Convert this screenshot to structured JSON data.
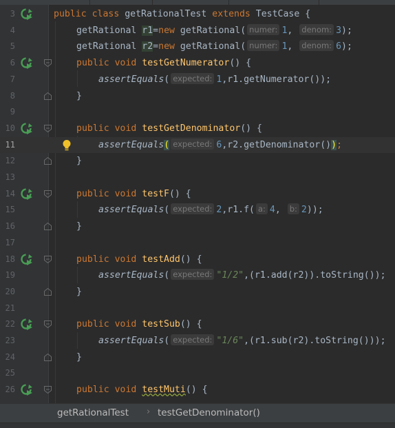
{
  "line_numbers": [
    "3",
    "4",
    "5",
    "6",
    "7",
    "8",
    "9",
    "10",
    "11",
    "12",
    "13",
    "14",
    "15",
    "16",
    "17",
    "18",
    "19",
    "20",
    "21",
    "22",
    "23",
    "24",
    "25",
    "26"
  ],
  "hints": {
    "numer": "numer:",
    "denom": "denom:",
    "expected": "expected:",
    "a": "a:",
    "b": "b:"
  },
  "code": {
    "l3": {
      "kw1": "public class ",
      "name": "getRationalTest ",
      "kw2": "extends ",
      "rest": "TestCase {"
    },
    "l4": {
      "type": "getRational ",
      "var": "r1",
      "assign": "=",
      "kw": "new ",
      "call": "getRational(",
      "n1": "1",
      "comma": ", ",
      "n2": "3",
      "end": ");"
    },
    "l5": {
      "type": "getRational ",
      "var": "r2",
      "assign": "=",
      "kw": "new ",
      "call": "getRational(",
      "n1": "1",
      "comma": ", ",
      "n2": "6",
      "end": ");"
    },
    "l6": {
      "kw": "public void ",
      "name": "testGetNumerator",
      "rest": "() {"
    },
    "l7": {
      "call": "assertEquals",
      "open": "(",
      "n": "1",
      "rest": ",r1.getNumerator());"
    },
    "l8": {
      "text": "}"
    },
    "l10": {
      "kw": "public void ",
      "name": "testGetDenominator",
      "rest": "() {"
    },
    "l11": {
      "call": "assertEquals",
      "open": "(",
      "n": "6",
      "rest": ",r2.getDenominator()",
      "close": ")",
      "semi": ";"
    },
    "l12": {
      "text": "}"
    },
    "l14": {
      "kw": "public void ",
      "name": "testF",
      "rest": "() {"
    },
    "l15": {
      "call": "assertEquals",
      "open": "(",
      "n": "2",
      "mid": ",r1.f(",
      "n1": "4",
      "comma": ", ",
      "n2": "2",
      "end": "));"
    },
    "l16": {
      "text": "}"
    },
    "l18": {
      "kw": "public void ",
      "name": "testAdd",
      "rest": "() {"
    },
    "l19": {
      "call": "assertEquals",
      "open": "(",
      "s": "\"1/2\"",
      "rest": ",(r1.add(r2)).toString());"
    },
    "l20": {
      "text": "}"
    },
    "l22": {
      "kw": "public void ",
      "name": "testSub",
      "rest": "() {"
    },
    "l23": {
      "call": "assertEquals",
      "open": "(",
      "s": "\"1/6\"",
      "rest": ",(r1.sub(r2).toString()));"
    },
    "l24": {
      "text": "}"
    },
    "l26": {
      "kw": "public void ",
      "name": "testMuti",
      "rest": "() {"
    }
  },
  "breadcrumb": {
    "class_name": "getRationalTest",
    "separator": "›",
    "method_name": "testGetDenominator()"
  },
  "colors": {
    "background": "#2b2b2b",
    "keyword": "#cc7832",
    "method": "#ffc66d",
    "number": "#6897bb",
    "string": "#6a8759",
    "run_icon": "#499c54"
  }
}
